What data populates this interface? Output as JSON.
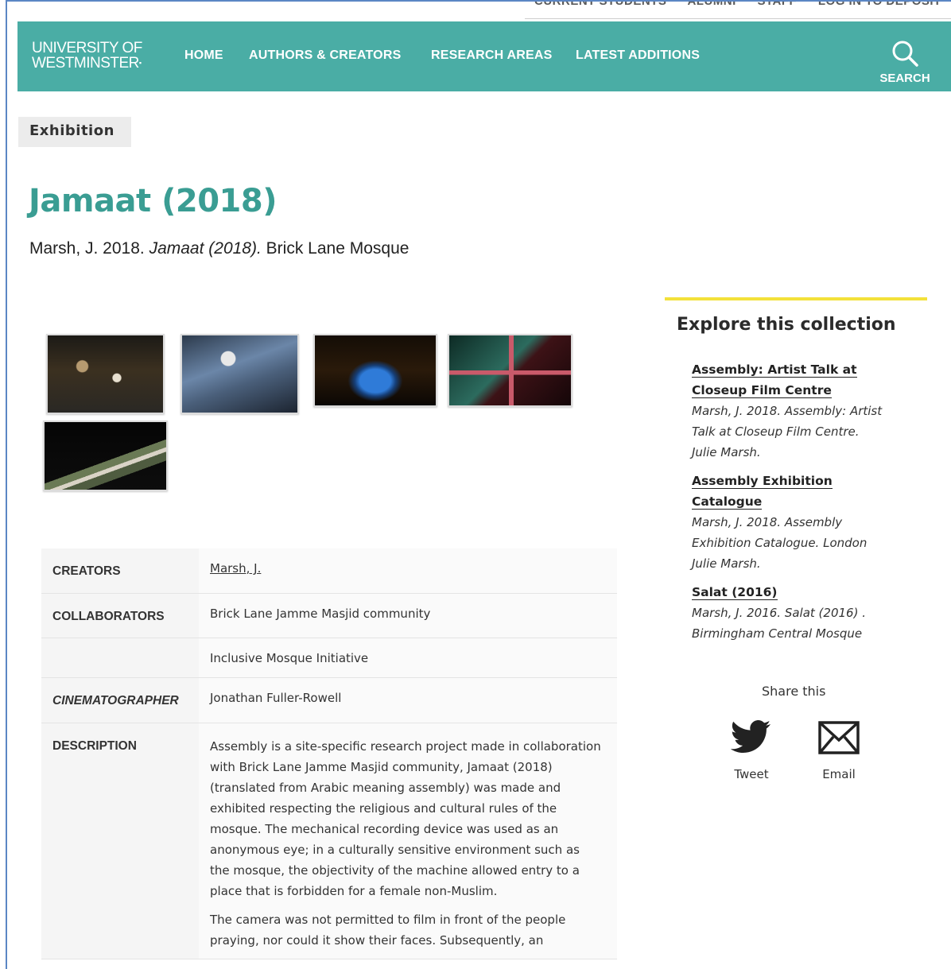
{
  "topbar": {
    "links": [
      "CURRENT STUDENTS",
      "ALUMNI",
      "STAFF",
      "LOG IN TO DEPOSIT"
    ]
  },
  "nav": {
    "logo_line1": "UNIVERSITY OF",
    "logo_line2": "WESTMINSTER",
    "items": [
      "HOME",
      "AUTHORS & CREATORS",
      "RESEARCH AREAS",
      "LATEST ADDITIONS"
    ],
    "search_label": "SEARCH",
    "accent_color": "#4aada5"
  },
  "page": {
    "type_badge": "Exhibition",
    "title": "Jamaat (2018)",
    "citation": {
      "prefix": "Marsh, J. 2018. ",
      "title": "Jamaat (2018).",
      "suffix": " Brick Lane Mosque"
    }
  },
  "metadata": {
    "creators_label": "CREATORS",
    "creators_value": "Marsh, J.",
    "collaborators_label": "COLLABORATORS",
    "collaborators": [
      "Brick Lane Jamme Masjid community",
      "Inclusive Mosque Initiative"
    ],
    "cinematographer_label": "CINEMATOGRAPHER",
    "cinematographer_value": "Jonathan Fuller-Rowell",
    "description_label": "DESCRIPTION",
    "description_paragraphs": [
      "Assembly is a site-specific research project made in collaboration with Brick Lane Jamme Masjid community, Jamaat (2018) (translated from Arabic meaning assembly) was made and exhibited respecting the religious and cultural rules of the mosque. The mechanical recording device was used as an anonymous eye; in a culturally sensitive environment such as the mosque, the objectivity of the machine allowed entry to a place that is forbidden for a female non-Muslim.",
      "The camera was not permitted to film in front of the people praying, nor could it show their faces. Subsequently, an"
    ]
  },
  "sidebar": {
    "heading": "Explore this collection",
    "accent_color": "#f3e13a",
    "items": [
      {
        "title_lines": [
          "Assembly: Artist Talk at",
          "Closeup Film Centre"
        ],
        "citation_lines": [
          "Marsh, J. 2018. Assembly: Artist",
          "Talk at Closeup Film Centre.",
          "Julie Marsh."
        ]
      },
      {
        "title_lines": [
          "Assembly Exhibition",
          "Catalogue"
        ],
        "citation_lines": [
          "Marsh, J. 2018. Assembly",
          "Exhibition Catalogue. London",
          "Julie Marsh."
        ]
      },
      {
        "title_lines": [
          "Salat (2016)"
        ],
        "citation_lines": [
          "Marsh, J. 2016. Salat (2016) .",
          "Birmingham Central Mosque"
        ]
      }
    ],
    "share_title": "Share this",
    "tweet_label": "Tweet",
    "email_label": "Email"
  }
}
